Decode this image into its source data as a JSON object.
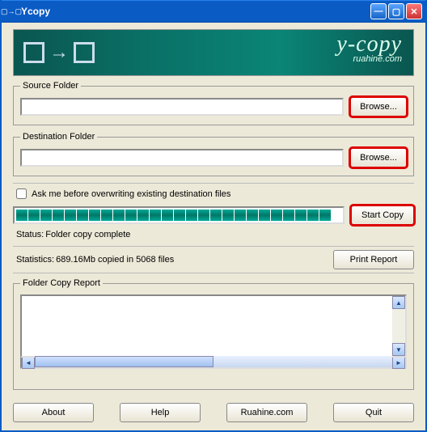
{
  "window": {
    "title": "Ycopy"
  },
  "banner": {
    "brand": "y-copy",
    "subtitle": "ruahine.com"
  },
  "source": {
    "legend": "Source Folder",
    "value": "",
    "browse_label": "Browse..."
  },
  "destination": {
    "legend": "Destination Folder",
    "value": "",
    "browse_label": "Browse..."
  },
  "options": {
    "overwrite_ask_label": "Ask me before overwriting existing destination files",
    "overwrite_ask_checked": false
  },
  "copy": {
    "start_label": "Start Copy",
    "progress_percent": 100
  },
  "status": {
    "prefix": "Status:",
    "text": "Folder copy complete"
  },
  "statistics": {
    "prefix": "Statistics:",
    "text": "689.16Mb copied in 5068 files",
    "print_report_label": "Print Report"
  },
  "report": {
    "legend": "Folder Copy Report",
    "content": ""
  },
  "footer": {
    "about_label": "About",
    "help_label": "Help",
    "site_label": "Ruahine.com",
    "quit_label": "Quit"
  }
}
